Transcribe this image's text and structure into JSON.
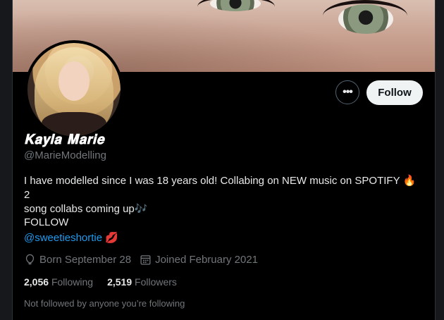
{
  "profile": {
    "display_name": "𝐊𝐚𝐲𝐥𝐚 𝐌𝐚𝐫𝐢𝐞",
    "handle": "@MarieModelling",
    "bio_line1": "I have modelled since I was 18 years old! Collabing on NEW music on SPOTIFY 🔥2",
    "bio_line2": "song collabs coming up🎶",
    "follow_word": "FOLLOW",
    "mention": "@sweetieshortie 💋",
    "born": "Born September 28",
    "joined": "Joined February 2021",
    "following_count": "2,056",
    "following_label": "Following",
    "followers_count": "2,519",
    "followers_label": "Followers",
    "not_followed": "Not followed by anyone you’re following"
  },
  "actions": {
    "more_label": "•••",
    "follow_label": "Follow"
  },
  "icons": {
    "more": "more-icon",
    "birthday": "balloon-icon",
    "joined": "calendar-icon"
  },
  "colors": {
    "background": "#000000",
    "link": "#1d9bf0",
    "muted": "#71767b",
    "follow_button": "#eff3f4"
  }
}
